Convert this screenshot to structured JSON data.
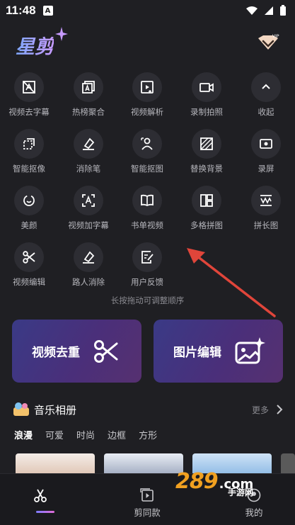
{
  "status": {
    "time": "11:48",
    "notif": "A"
  },
  "header": {
    "logo": "星剪",
    "vip_label": "VIP"
  },
  "tools": [
    {
      "label": "视频去字幕"
    },
    {
      "label": "热榜聚合"
    },
    {
      "label": "视频解析"
    },
    {
      "label": "录制拍照"
    },
    {
      "label": "收起"
    },
    {
      "label": "智能抠像"
    },
    {
      "label": "消除笔"
    },
    {
      "label": "智能抠图"
    },
    {
      "label": "替换背景"
    },
    {
      "label": "录屏"
    },
    {
      "label": "美颜"
    },
    {
      "label": "视频加字幕"
    },
    {
      "label": "书单视频"
    },
    {
      "label": "多格拼图"
    },
    {
      "label": "拼长图"
    },
    {
      "label": "视频编辑"
    },
    {
      "label": "路人消除"
    },
    {
      "label": "用户反馈"
    }
  ],
  "hint": "长按拖动可调整顺序",
  "cards": {
    "video_dedup": "视频去重",
    "image_edit": "图片编辑"
  },
  "music": {
    "title": "音乐相册",
    "more": "更多",
    "tags": [
      "浪漫",
      "可爱",
      "时尚",
      "边框",
      "方形"
    ]
  },
  "nav": {
    "home": "",
    "templates": "剪同款",
    "mine": "我的"
  },
  "watermark": {
    "brand": "289",
    "com": ".com",
    "sub": "手游网"
  },
  "colors": {
    "accent_start": "#7c7cff",
    "accent_end": "#e26bd6",
    "arrow": "#e0453a",
    "card": "#3a3a86"
  }
}
